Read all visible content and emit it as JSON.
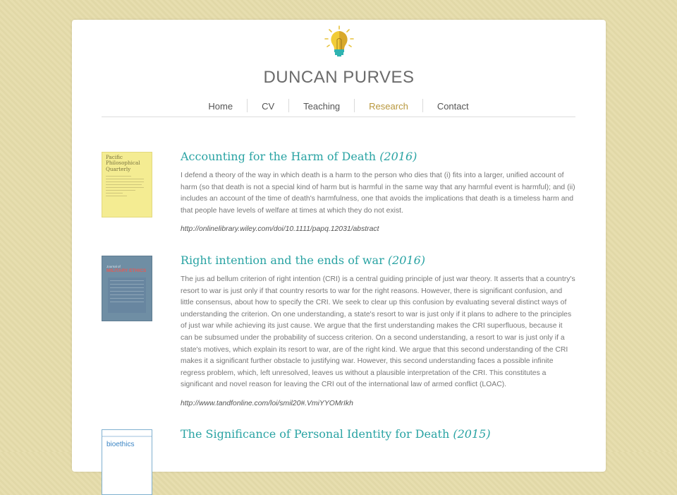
{
  "site": {
    "title": "DUNCAN PURVES",
    "logo_icon": "lightbulb-icon"
  },
  "nav": {
    "items": [
      {
        "label": "Home"
      },
      {
        "label": "CV"
      },
      {
        "label": "Teaching"
      },
      {
        "label": "Research",
        "active": true
      },
      {
        "label": "Contact"
      }
    ]
  },
  "colors": {
    "accent": "#29a3a3",
    "nav_active": "#b8973c",
    "background": "#e6dcaa"
  },
  "entries": [
    {
      "title": "Accounting for the Harm of Death",
      "year": "(2016)",
      "abstract": "I defend a theory of the way in which death is a harm to the person who dies that (i) fits into a larger, unified account of harm (so that death is not a special kind of harm but is harmful in the same way that any harmful event is harmful); and (ii) includes an account of the time of death's harmfulness, one that avoids the implications that death is a timeless harm and that people have levels of welfare at times at which they do not exist.",
      "link": "http://onlinelibrary.wiley.com/doi/10.1111/papq.12031/abstract",
      "cover_title": "Pacific Philosophical Quarterly"
    },
    {
      "title": "Right intention and the ends of war",
      "year": "(2016)",
      "abstract": "The jus ad bellum criterion of right intention (CRI) is a central guiding principle of just war theory. It asserts that a country's resort to war is just only if that country resorts to war for the right reasons. However, there is significant confusion, and little consensus, about how to specify the CRI. We seek to clear up this confusion by evaluating several distinct ways of understanding the criterion. On one understanding, a state's resort to war is just only if it plans to adhere to the principles of just war while achieving its just cause. We argue that the first understanding makes the CRI superfluous, because it can be subsumed under the probability of success criterion. On a second understanding, a resort to war is just only if a state's motives, which explain its resort to war, are of the right kind. We argue that this second understanding of the CRI makes it a significant further obstacle to justifying war. However, this second understanding faces a possible infinite regress problem, which, left unresolved, leaves us without a plausible interpretation of the CRI. This constitutes a significant and novel reason for leaving the CRI out of the international law of armed conflict (LOAC).",
      "link": "http://www.tandfonline.com/loi/smil20#.VmiYYOMrIkh",
      "cover_title": "MILITARY ETHICS",
      "cover_subtitle": "Journal of"
    },
    {
      "title": "The Significance of Personal Identity for Death",
      "year": "(2015)",
      "cover_title": "bioethics"
    }
  ]
}
